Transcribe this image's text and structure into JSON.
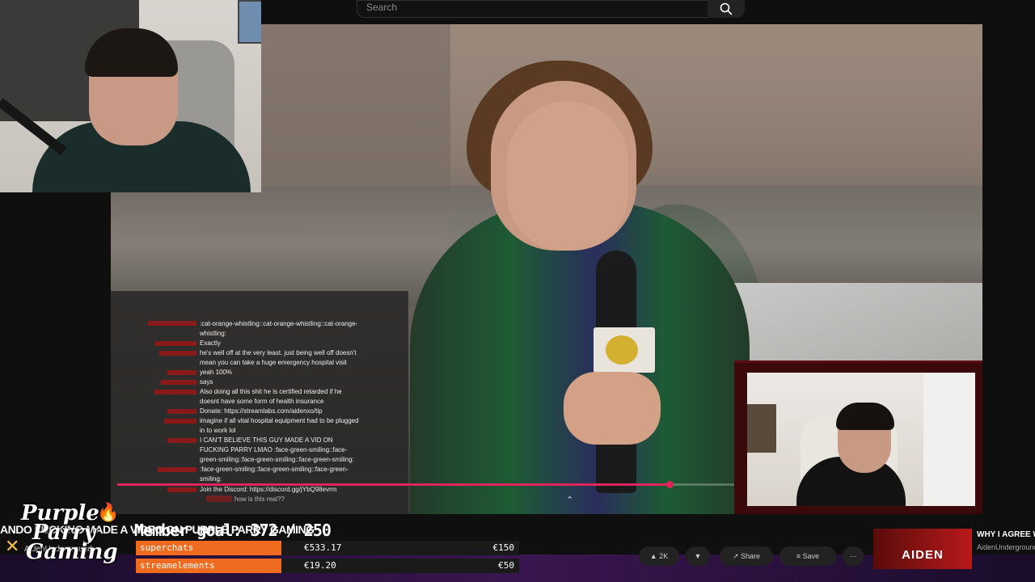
{
  "search": {
    "placeholder": "Search",
    "icon": "search-icon"
  },
  "chat": {
    "messages": [
      {
        "text": ":cat-orange-whistling::cat-orange-whistling::cat-orange-whistling:"
      },
      {
        "text": "Exactly"
      },
      {
        "text": "he's well off at the very least. just being well off doesn't mean you can take a huge emergency hospital visit"
      },
      {
        "text": "yeah 100%"
      },
      {
        "text": "says"
      },
      {
        "text": "Also doing all this shit he is certified retarded if he doesnt have some form of health insurance"
      },
      {
        "text": "Donate: https://streamlabs.com/aidenxo/tip"
      },
      {
        "text": "imagine if all vital hospital equipment had to be plugged in to work lol"
      },
      {
        "text": "I CAN'T BELIEVE THIS GUY MADE A VID ON FUCKING PARRY LMAO :face-green-smiling::face-green-smiling::face-green-smiling::face-green-smiling:"
      },
      {
        "text": ":face-green-smiling::face-green-smiling::face-green-smiling:"
      },
      {
        "text": "Join the Discord: https://discord.gg/jYbQ98evrm"
      }
    ],
    "last_message": "how is this real??"
  },
  "overlay": {
    "ticker": "ANDO FUCKING MADE A VIDEO ON PURPLE PARRY GAMING",
    "goal": "Member goal: 372 / 250"
  },
  "donations": [
    {
      "label": "superchats",
      "amount": "€533.17",
      "goal": "€150",
      "fill": 0.38,
      "color": "#ee6b1f"
    },
    {
      "label": "streamelements",
      "amount": "€19.20",
      "goal": "€50",
      "fill": 0.38,
      "color": "#ee6b1f"
    }
  ],
  "logo": {
    "line1": "Purple",
    "line2": "Parry",
    "line3": "Gaming",
    "sub": "AidenUnderground"
  },
  "video": {
    "progress": 0.895,
    "mic_flag_icon": "mic-flag-logo"
  },
  "recommended": {
    "thumb_text": "AIDEN",
    "title": "WHY I AGREE W",
    "channel": "AidenUnderground"
  }
}
